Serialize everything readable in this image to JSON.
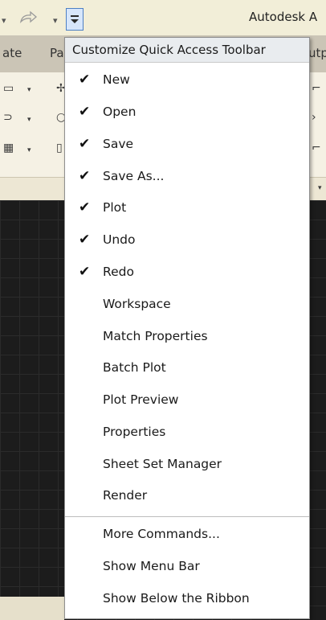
{
  "app": {
    "title": "Autodesk A"
  },
  "ribbon_tabs": [
    {
      "label": "ate"
    },
    {
      "label": "Pa"
    },
    {
      "label": "utp"
    }
  ],
  "menu": {
    "header": "Customize Quick Access Toolbar",
    "items": [
      {
        "label": "New",
        "checked": true
      },
      {
        "label": "Open",
        "checked": true
      },
      {
        "label": "Save",
        "checked": true
      },
      {
        "label": "Save As...",
        "checked": true
      },
      {
        "label": "Plot",
        "checked": true
      },
      {
        "label": "Undo",
        "checked": true
      },
      {
        "label": "Redo",
        "checked": true
      },
      {
        "label": "Workspace",
        "checked": false
      },
      {
        "label": "Match Properties",
        "checked": false
      },
      {
        "label": "Batch Plot",
        "checked": false
      },
      {
        "label": "Plot Preview",
        "checked": false
      },
      {
        "label": "Properties",
        "checked": false
      },
      {
        "label": "Sheet Set Manager",
        "checked": false
      },
      {
        "label": "Render",
        "checked": false
      }
    ],
    "extra_items": [
      {
        "label": "More Commands..."
      },
      {
        "label": "Show Menu Bar"
      },
      {
        "label": "Show Below the Ribbon"
      }
    ],
    "check_glyph": "✔"
  },
  "colors": {
    "canvas": "#1c1c1c",
    "menu_header": "#e9ecef",
    "button_highlight": "#d7e6fb"
  }
}
